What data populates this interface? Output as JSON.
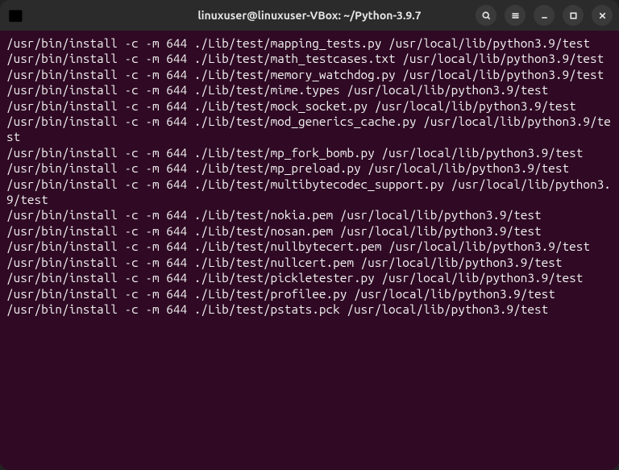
{
  "window": {
    "title": "linuxuser@linuxuser-VBox: ~/Python-3.9.7"
  },
  "terminal": {
    "lines": [
      "/usr/bin/install -c -m 644 ./Lib/test/mapping_tests.py /usr/local/lib/python3.9/test",
      "/usr/bin/install -c -m 644 ./Lib/test/math_testcases.txt /usr/local/lib/python3.9/test",
      "/usr/bin/install -c -m 644 ./Lib/test/memory_watchdog.py /usr/local/lib/python3.9/test",
      "/usr/bin/install -c -m 644 ./Lib/test/mime.types /usr/local/lib/python3.9/test",
      "/usr/bin/install -c -m 644 ./Lib/test/mock_socket.py /usr/local/lib/python3.9/test",
      "/usr/bin/install -c -m 644 ./Lib/test/mod_generics_cache.py /usr/local/lib/python3.9/test",
      "/usr/bin/install -c -m 644 ./Lib/test/mp_fork_bomb.py /usr/local/lib/python3.9/test",
      "/usr/bin/install -c -m 644 ./Lib/test/mp_preload.py /usr/local/lib/python3.9/test",
      "/usr/bin/install -c -m 644 ./Lib/test/multibytecodec_support.py /usr/local/lib/python3.9/test",
      "/usr/bin/install -c -m 644 ./Lib/test/nokia.pem /usr/local/lib/python3.9/test",
      "/usr/bin/install -c -m 644 ./Lib/test/nosan.pem /usr/local/lib/python3.9/test",
      "/usr/bin/install -c -m 644 ./Lib/test/nullbytecert.pem /usr/local/lib/python3.9/test",
      "/usr/bin/install -c -m 644 ./Lib/test/nullcert.pem /usr/local/lib/python3.9/test",
      "/usr/bin/install -c -m 644 ./Lib/test/pickletester.py /usr/local/lib/python3.9/test",
      "/usr/bin/install -c -m 644 ./Lib/test/profilee.py /usr/local/lib/python3.9/test",
      "/usr/bin/install -c -m 644 ./Lib/test/pstats.pck /usr/local/lib/python3.9/test"
    ]
  }
}
